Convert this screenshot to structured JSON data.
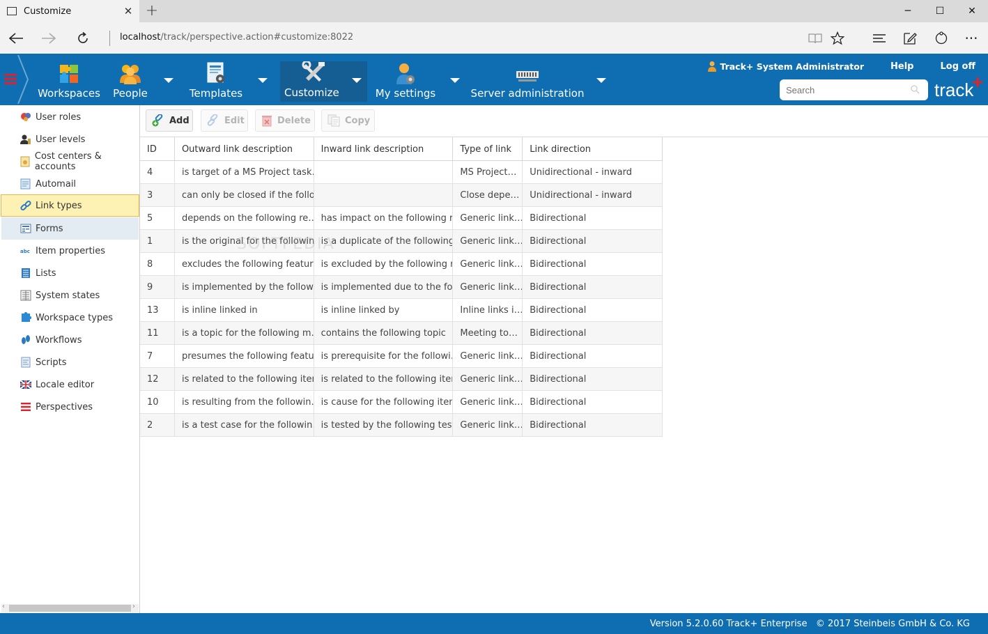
{
  "browser": {
    "tab_title": "Customize",
    "url_host": "localhost",
    "url_path": "/track/perspective.action#customize:8022",
    "colors": {
      "chrome": "#f2f2f2",
      "titlebar": "#dadada"
    }
  },
  "header": {
    "brand": "track",
    "brand_plus": "+",
    "nav": [
      {
        "label": "Workspaces",
        "icon": "puzzle-icon",
        "has_dropdown": false
      },
      {
        "label": "People",
        "icon": "people-icon",
        "has_dropdown": true
      },
      {
        "label": "Templates",
        "icon": "template-icon",
        "has_dropdown": true
      },
      {
        "label": "Customize",
        "icon": "tools-icon",
        "has_dropdown": true,
        "active": true
      },
      {
        "label": "My settings",
        "icon": "user-settings-icon",
        "has_dropdown": true
      },
      {
        "label": "Server administration",
        "icon": "server-icon",
        "has_dropdown": true
      }
    ],
    "user_name": "Track+ System Administrator",
    "help_label": "Help",
    "logoff_label": "Log off",
    "search_placeholder": "Search",
    "colors": {
      "header_bg": "#0e6eb1",
      "accent_red": "#e0232c"
    }
  },
  "sidebar": {
    "items": [
      {
        "label": "User roles",
        "icon": "user-roles-icon"
      },
      {
        "label": "User levels",
        "icon": "user-levels-icon"
      },
      {
        "label": "Cost centers & accounts",
        "icon": "cost-centers-icon"
      },
      {
        "label": "Automail",
        "icon": "automail-icon"
      },
      {
        "label": "Link types",
        "icon": "link-icon",
        "selected": true
      },
      {
        "label": "Forms",
        "icon": "forms-icon",
        "hover": true
      },
      {
        "label": "Item properties",
        "icon": "item-properties-icon"
      },
      {
        "label": "Lists",
        "icon": "lists-icon"
      },
      {
        "label": "System states",
        "icon": "system-states-icon"
      },
      {
        "label": "Workspace types",
        "icon": "workspace-types-icon"
      },
      {
        "label": "Workflows",
        "icon": "workflows-icon"
      },
      {
        "label": "Scripts",
        "icon": "scripts-icon"
      },
      {
        "label": "Locale editor",
        "icon": "locale-flag-icon"
      },
      {
        "label": "Perspectives",
        "icon": "perspectives-icon"
      }
    ]
  },
  "toolbar": {
    "add_label": "Add",
    "edit_label": "Edit",
    "delete_label": "Delete",
    "copy_label": "Copy"
  },
  "grid": {
    "columns": [
      "ID",
      "Outward link description",
      "Inward link description",
      "Type of link",
      "Link direction"
    ],
    "rows": [
      [
        "4",
        "is target of a MS Project task…",
        "",
        "MS Project…",
        "Unidirectional - inward"
      ],
      [
        "3",
        "can only be closed if the follo…",
        "",
        "Close depe…",
        "Unidirectional - inward"
      ],
      [
        "5",
        "depends on the following re…",
        "has impact on the following r…",
        "Generic link…",
        "Bidirectional"
      ],
      [
        "1",
        "is the original for the followin…",
        "is a duplicate of the following…",
        "Generic link…",
        "Bidirectional"
      ],
      [
        "8",
        "excludes the following feature",
        "is excluded by the following r…",
        "Generic link…",
        "Bidirectional"
      ],
      [
        "9",
        "is implemented by the follow…",
        "is implemented due to the fo…",
        "Generic link…",
        "Bidirectional"
      ],
      [
        "13",
        "is inline linked in",
        "is inline linked by",
        "Inline links i…",
        "Bidirectional"
      ],
      [
        "11",
        "is a topic for the following m…",
        "contains the following topic",
        "Meeting to…",
        "Bidirectional"
      ],
      [
        "7",
        "presumes the following featu…",
        "is prerequisite for the followi…",
        "Generic link…",
        "Bidirectional"
      ],
      [
        "12",
        "is related to the following item",
        "is related to the following item",
        "Generic link…",
        "Bidirectional"
      ],
      [
        "10",
        "is resulting from the followin…",
        "is cause for the following item",
        "Generic link…",
        "Bidirectional"
      ],
      [
        "2",
        "is a test case for the followin…",
        "is tested by the following test…",
        "Generic link…",
        "Bidirectional"
      ]
    ]
  },
  "watermark": "SOFTPEDIA",
  "footer": {
    "text": "Version 5.2.0.60 Track+ Enterprise   © 2017 Steinbeis GmbH & Co. KG"
  }
}
